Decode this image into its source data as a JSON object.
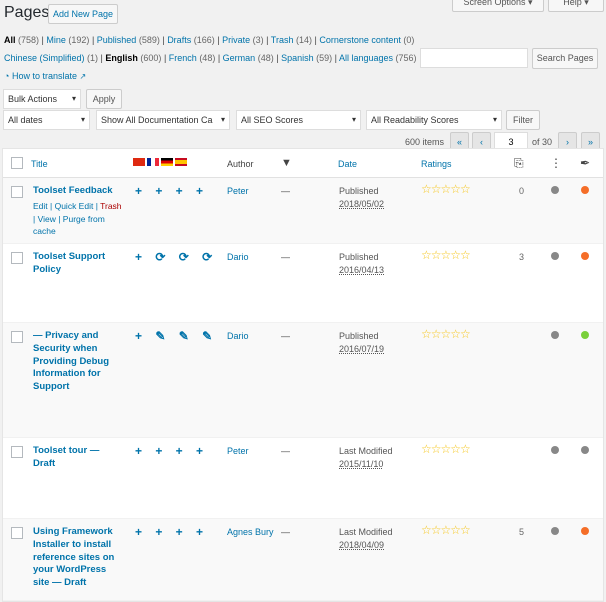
{
  "header": {
    "title": "Pages",
    "add_new": "Add New Page",
    "screen_options": "Screen Options ▾",
    "help": "Help ▾"
  },
  "status_links": [
    {
      "label": "All",
      "count": "(758)"
    },
    {
      "label": "Mine",
      "count": "(192)"
    },
    {
      "label": "Published",
      "count": "(589)"
    },
    {
      "label": "Drafts",
      "count": "(166)"
    },
    {
      "label": "Private",
      "count": "(3)"
    },
    {
      "label": "Trash",
      "count": "(14)"
    },
    {
      "label": "Cornerstone content",
      "count": "(0)"
    }
  ],
  "lang_links": [
    {
      "label": "Chinese (Simplified)",
      "count": "(1)"
    },
    {
      "label": "English",
      "count": "(600)"
    },
    {
      "label": "French",
      "count": "(48)"
    },
    {
      "label": "German",
      "count": "(48)"
    },
    {
      "label": "Spanish",
      "count": "(59)"
    },
    {
      "label": "All languages",
      "count": "(756)"
    }
  ],
  "search": {
    "value": "",
    "button": "Search Pages"
  },
  "how_to_translate": "How to translate",
  "bulk": {
    "selected": "Bulk Actions",
    "apply": "Apply"
  },
  "filters": {
    "dates": "All dates",
    "docs": "Show All Documentation Ca",
    "seo": "All SEO Scores",
    "readability": "All Readability Scores",
    "filter": "Filter"
  },
  "pagination": {
    "items": "600 items",
    "first": "«",
    "prev": "‹",
    "current": "3",
    "of": "of 30",
    "next": "›",
    "last": "»"
  },
  "columns": {
    "title": "Title",
    "author": "Author",
    "date": "Date",
    "ratings": "Ratings"
  },
  "colors": {
    "link": "#0073aa",
    "trash": "#a00",
    "seo_orange": "#f56e28",
    "seo_green": "#7ad03a",
    "grey": "#888888"
  },
  "rows": [
    {
      "title": "Toolset Feedback",
      "langs": "+ + + +",
      "author": "Peter",
      "comments": "—",
      "status": "Published",
      "date": "2018/05/02",
      "stars": "☆☆☆☆☆",
      "links": "0",
      "seo": "orange",
      "actions": {
        "edit": "Edit",
        "quick_edit": "Quick Edit",
        "trash": "Trash",
        "view": "View",
        "purge": "Purge from cache"
      }
    },
    {
      "title": "Toolset Support Policy",
      "langs": "+ ⟳ ⟳ ⟳",
      "author": "Dario",
      "comments": "—",
      "status": "Published",
      "date": "2016/04/13",
      "stars": "☆☆☆☆☆",
      "links": "3",
      "seo": "orange"
    },
    {
      "title": "— Privacy and Security when Providing Debug Information for Support",
      "langs": "+ ✎ ✎ ✎",
      "author": "Dario",
      "comments": "—",
      "status": "Published",
      "date": "2016/07/19",
      "stars": "☆☆☆☆☆",
      "links": "",
      "seo": "green"
    },
    {
      "title": "Toolset tour — Draft",
      "langs": "+ + + +",
      "author": "Peter",
      "comments": "—",
      "status": "Last Modified",
      "date": "2015/11/10",
      "stars": "☆☆☆☆☆",
      "links": "",
      "seo": "grey"
    },
    {
      "title": "Using Framework Installer to install reference sites on your WordPress site — Draft",
      "langs": "+ + + +",
      "author": "Agnes Bury",
      "comments": "—",
      "status": "Last Modified",
      "date": "2018/04/09",
      "stars": "☆☆☆☆☆",
      "links": "5",
      "seo": "orange"
    }
  ]
}
